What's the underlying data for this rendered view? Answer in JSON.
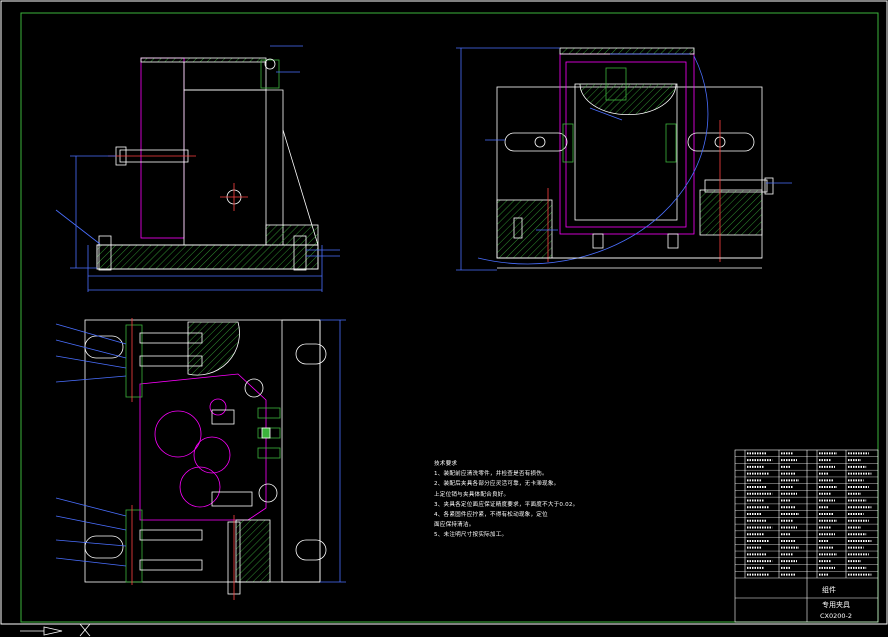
{
  "drawing": {
    "colors": {
      "background": "#000000",
      "outline": "#ffffff",
      "hatch": "#3cb43c",
      "part": "#ff00ff",
      "dimension": "#4a6fff",
      "centerline": "#ff4040",
      "text": "#ffffff",
      "frame": "#ffffff",
      "border": "#3cb43c"
    },
    "views": [
      "front-view",
      "side-view",
      "top-view"
    ],
    "tech_requirements": {
      "title": "技术要求",
      "lines": [
        "1、装配前应清洗零件，并检查是否有损伤。",
        "2、装配后夹具各部分应灵活可靠，无卡滞现象。",
        "   上定位销与夹具体配合良好。",
        "3、夹具各定位面应保证精度要求，平面度不大于0.02。",
        "4、各紧固件应拧紧，不得有松动现象，定位",
        "   面应保持清洁。",
        "5、未注明尺寸按实际加工。"
      ]
    },
    "title_block": {
      "name": "专用夹具",
      "drawing_no": "CX0200-2",
      "material": "组件"
    },
    "bom_rows": 19
  }
}
